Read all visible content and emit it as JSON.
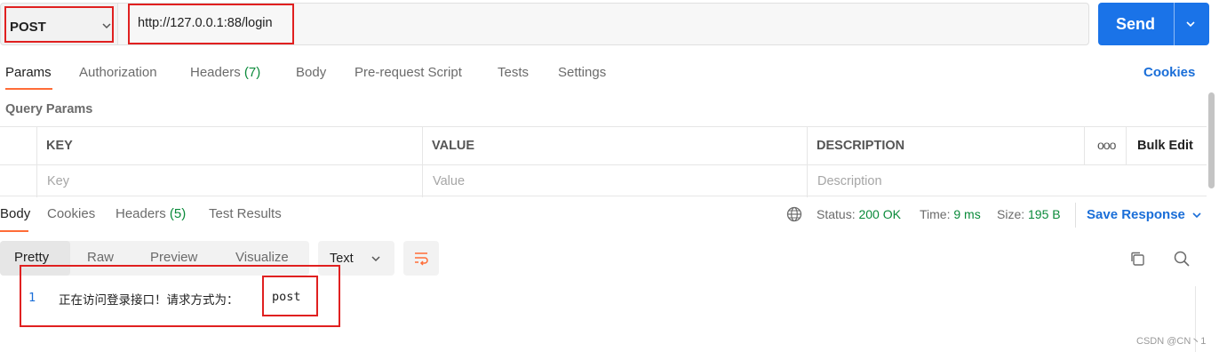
{
  "request": {
    "method": "POST",
    "url": "http://127.0.0.1:88/login",
    "send_label": "Send"
  },
  "request_tabs": {
    "params": "Params",
    "authorization": "Authorization",
    "headers": "Headers",
    "headers_count": "(7)",
    "body": "Body",
    "pre_request_script": "Pre-request Script",
    "tests": "Tests",
    "settings": "Settings",
    "cookies": "Cookies"
  },
  "query_params": {
    "title": "Query Params",
    "columns": [
      "KEY",
      "VALUE",
      "DESCRIPTION"
    ],
    "bulk_edit": "Bulk Edit",
    "more": "ooo",
    "placeholders": {
      "key": "Key",
      "value": "Value",
      "description": "Description"
    }
  },
  "response_tabs": {
    "body": "Body",
    "cookies": "Cookies",
    "headers": "Headers",
    "headers_count": "(5)",
    "test_results": "Test Results"
  },
  "response_status": {
    "status_label": "Status:",
    "status_value": "200 OK",
    "time_label": "Time:",
    "time_value": "9 ms",
    "size_label": "Size:",
    "size_value": "195 B",
    "save_response": "Save Response"
  },
  "view": {
    "tabs": [
      "Pretty",
      "Raw",
      "Preview",
      "Visualize"
    ],
    "format": "Text"
  },
  "response_body": {
    "line_number": "1",
    "text": "正在访问登录接口！请求方式为：",
    "method": "post"
  },
  "watermark": "CSDN @CN丶1",
  "colors": {
    "accent_orange": "#ff6c37",
    "send_blue": "#1a73e8",
    "link_blue": "#1a6ed8",
    "status_green": "#0a8a3a",
    "highlight_red": "#e02020"
  }
}
